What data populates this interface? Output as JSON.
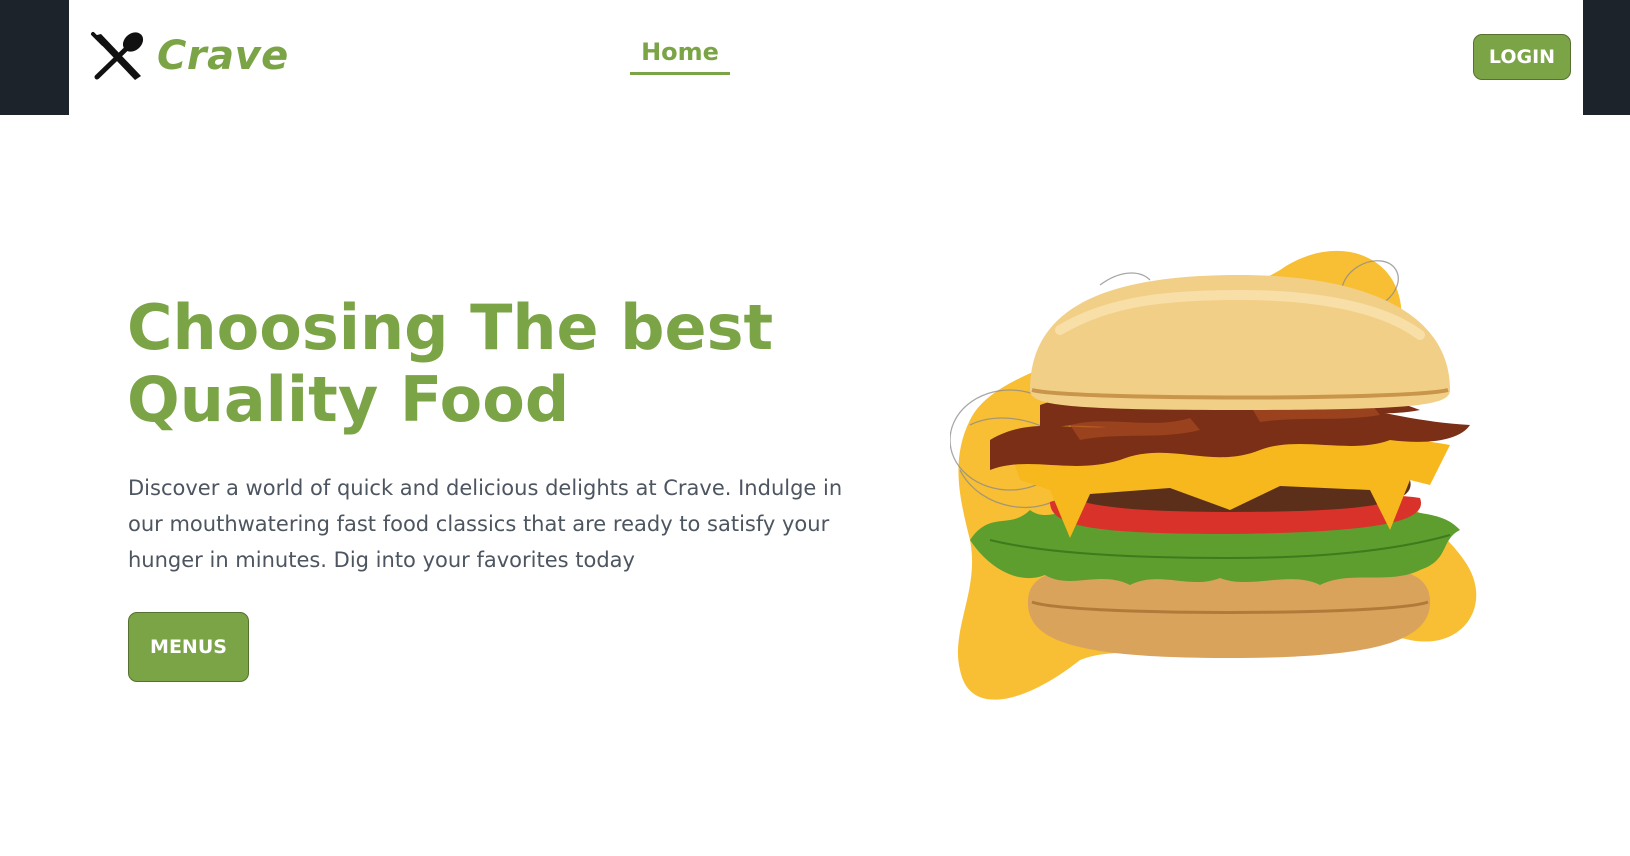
{
  "brand": {
    "name": "Crave",
    "logo_icon": "crossed-fork-spoon-icon"
  },
  "nav": {
    "home_label": "Home"
  },
  "header": {
    "login_label": "LOGIN"
  },
  "hero": {
    "title_line1": "Choosing The best",
    "title_line2": "Quality Food",
    "description": "Discover a world of quick and delicious delights at Crave. Indulge in our mouthwatering fast food classics that are ready to satisfy your hunger in minutes. Dig into your favorites today",
    "menus_label": "MENUS",
    "image_icon": "burger-image"
  },
  "colors": {
    "accent": "#7ba446",
    "dark_sidebar": "#1c232b",
    "blob_yellow": "#f8bf34",
    "text_muted": "#4d5560"
  }
}
